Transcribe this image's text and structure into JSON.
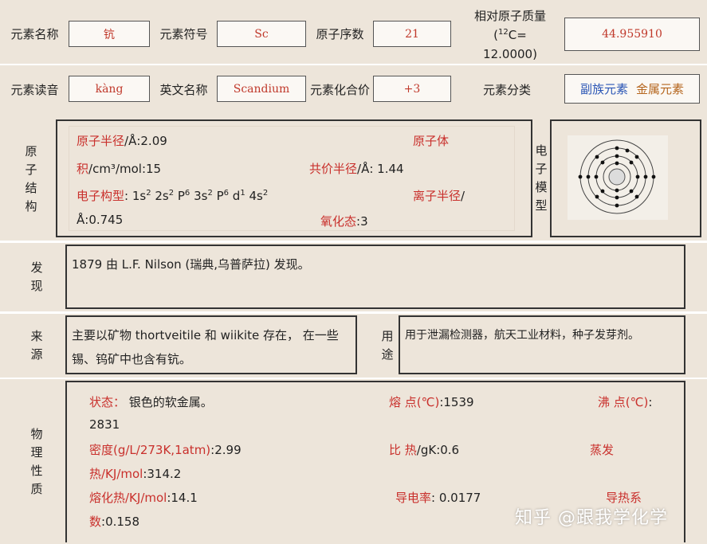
{
  "header": {
    "name_label": "元素名称",
    "name_value": "钪",
    "symbol_label": "元素符号",
    "symbol_value": "Sc",
    "number_label": "原子序数",
    "number_value": "21",
    "mass_label_line1": "相对原子质量",
    "mass_label_sup": "12",
    "mass_label_mid": "C=",
    "mass_label_line3": "12.0000)",
    "mass_value": "44.955910",
    "reading_label": "元素读音",
    "reading_value": "kàng",
    "english_label": "英文名称",
    "english_value": "Scandium",
    "valence_label": "元素化合价",
    "valence_value": "+3",
    "category_label": "元素分类",
    "category_value_1": "副族元素",
    "category_value_2": "金属元素"
  },
  "atomic_structure": {
    "label": [
      "原",
      "子",
      "结",
      "构"
    ],
    "radius_label": "原子半径",
    "radius_value": "/Å:2.09",
    "volume_label_a": "原子体",
    "volume_label_b": "积",
    "volume_value": "/cm³/mol:15",
    "covalent_label": "共价半径",
    "covalent_value": "/Å: 1.44",
    "config_label": "电子构型",
    "ionic_label": "离子半径",
    "ionic_value": "Å:0.745",
    "oxidation_label": "氧化态",
    "oxidation_value": ":3",
    "model_label": [
      "电",
      "子",
      "模",
      "型"
    ]
  },
  "discovery": {
    "label": [
      "发",
      "现"
    ],
    "text": "1879 由 L.F. Nilson (瑞典,乌普萨拉) 发现。"
  },
  "source": {
    "label": [
      "来",
      "源"
    ],
    "text_line1": "主要以矿物 thortveitile 和 wiikite 存在， 在一些",
    "text_line2": "锡、钨矿中也含有钪。"
  },
  "uses": {
    "label": [
      "用",
      "途"
    ],
    "text": "用于泄漏检测器，航天工业材料，种子发芽剂。"
  },
  "physical": {
    "label": [
      "物",
      "理",
      "性",
      "质"
    ],
    "state_label": "状态：",
    "state_value": " 银色的软金属。",
    "melting_label": "熔 点(℃)",
    "melting_value": ":1539",
    "boiling_label": "沸 点(℃)",
    "boiling_colon": ":",
    "boiling_value": "2831",
    "density_label": "密度(g/L/273K,1atm)",
    "density_value": ":2.99",
    "specific_heat_label": "比 热",
    "specific_heat_value": "/gK:0.6",
    "evap_label_a": "蒸发",
    "evap_label_b": "热/KJ/mol",
    "evap_value": ":314.2",
    "fusion_label": "熔化热/KJ/mol",
    "fusion_value": ":14.1",
    "conductivity_label": "导电率",
    "conductivity_value": ": 0.0177",
    "thermal_label_a": "导热系",
    "thermal_label_b": "数",
    "thermal_value": ":0.158"
  },
  "watermark": "知乎 @跟我学化学"
}
